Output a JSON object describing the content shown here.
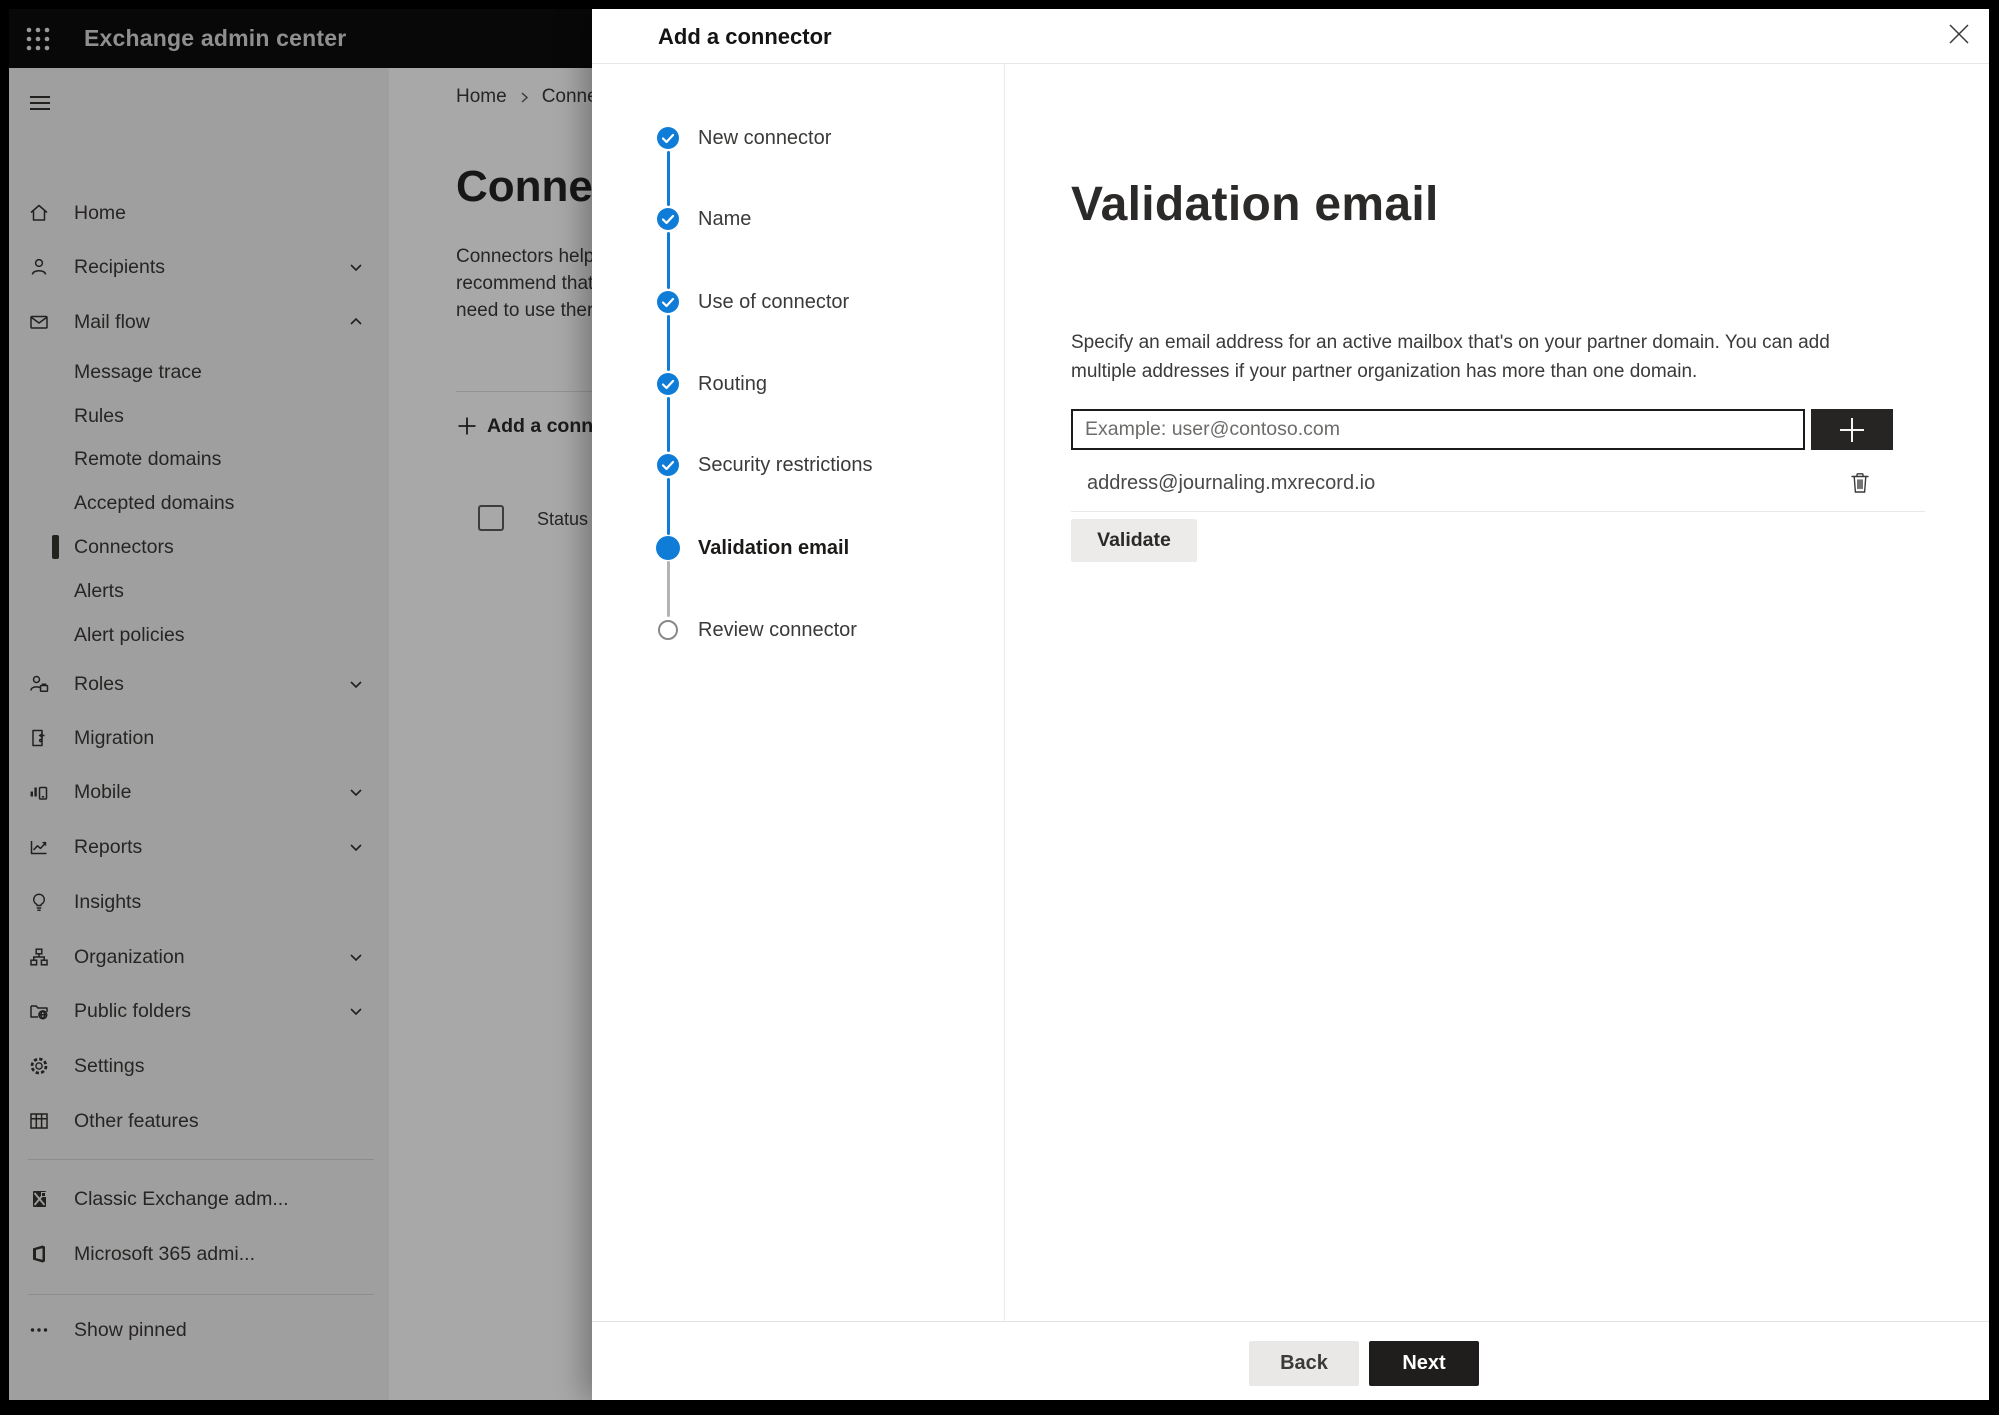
{
  "app": {
    "title": "Exchange admin center"
  },
  "sidebar": {
    "items": [
      {
        "label": "Home"
      },
      {
        "label": "Recipients"
      },
      {
        "label": "Mail flow"
      },
      {
        "label": "Roles"
      },
      {
        "label": "Migration"
      },
      {
        "label": "Mobile"
      },
      {
        "label": "Reports"
      },
      {
        "label": "Insights"
      },
      {
        "label": "Organization"
      },
      {
        "label": "Public folders"
      },
      {
        "label": "Settings"
      },
      {
        "label": "Other features"
      },
      {
        "label": "Classic Exchange adm..."
      },
      {
        "label": "Microsoft 365 admi..."
      },
      {
        "label": "Show pinned"
      }
    ],
    "mailflow_subitems": [
      {
        "label": "Message trace"
      },
      {
        "label": "Rules"
      },
      {
        "label": "Remote domains"
      },
      {
        "label": "Accepted domains"
      },
      {
        "label": "Connectors",
        "selected": true
      },
      {
        "label": "Alerts"
      },
      {
        "label": "Alert policies"
      }
    ]
  },
  "page": {
    "breadcrumb": {
      "home": "Home",
      "current": "Conne"
    },
    "heading": "Connect",
    "intro_lines": [
      "Connectors help",
      "recommend that",
      "need to use ther"
    ],
    "add_button": "Add a conn",
    "table": {
      "status_header": "Status"
    }
  },
  "modal": {
    "title": "Add a connector",
    "steps": [
      {
        "label": "New connector",
        "state": "done"
      },
      {
        "label": "Name",
        "state": "done"
      },
      {
        "label": "Use of connector",
        "state": "done"
      },
      {
        "label": "Routing",
        "state": "done"
      },
      {
        "label": "Security restrictions",
        "state": "done"
      },
      {
        "label": "Validation email",
        "state": "current"
      },
      {
        "label": "Review connector",
        "state": "upcoming"
      }
    ],
    "content": {
      "heading": "Validation email",
      "description": "Specify an email address for an active mailbox that's on your partner domain. You can add multiple addresses if your partner organization has more than one domain.",
      "email_input": {
        "value": "",
        "placeholder": "Example: user@contoso.com"
      },
      "addresses": [
        {
          "email": "address@journaling.mxrecord.io"
        }
      ],
      "validate_button": "Validate"
    },
    "footer": {
      "back_button": "Back",
      "next_button": "Next"
    }
  },
  "colors": {
    "accent_blue": "#0f7dd7",
    "appbar_background": "#0d0d0d",
    "dark_button": "#1f1e1d",
    "light_button": "#edebe9",
    "sidebar_background": "#f3f2f1"
  }
}
